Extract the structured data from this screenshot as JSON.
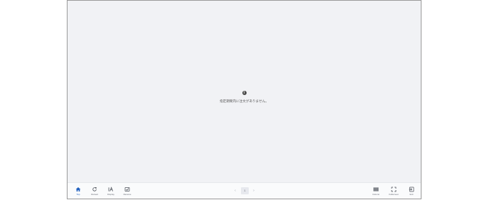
{
  "main": {
    "empty_message": "指定期間内に注文がありません。",
    "info_icon_glyph": "i"
  },
  "toolbar": {
    "left": [
      {
        "label": "Top",
        "icon": "home-icon",
        "active": true
      },
      {
        "label": "Reload",
        "icon": "refresh-icon",
        "active": false
      },
      {
        "label": "Display",
        "icon": "text-size-icon",
        "active": false
      },
      {
        "label": "Receive",
        "icon": "receive-check-icon",
        "active": false
      }
    ],
    "right": [
      {
        "label": "Column",
        "icon": "columns-icon"
      },
      {
        "label": "Fullscreen",
        "icon": "fullscreen-icon"
      },
      {
        "label": "Exit",
        "icon": "exit-icon"
      }
    ]
  },
  "pagination": {
    "prev": "‹",
    "current_page": "1",
    "next": "›"
  },
  "colors": {
    "background": "#f1f2f5",
    "accent": "#1f5fbf",
    "icon": "#4a4f58"
  }
}
